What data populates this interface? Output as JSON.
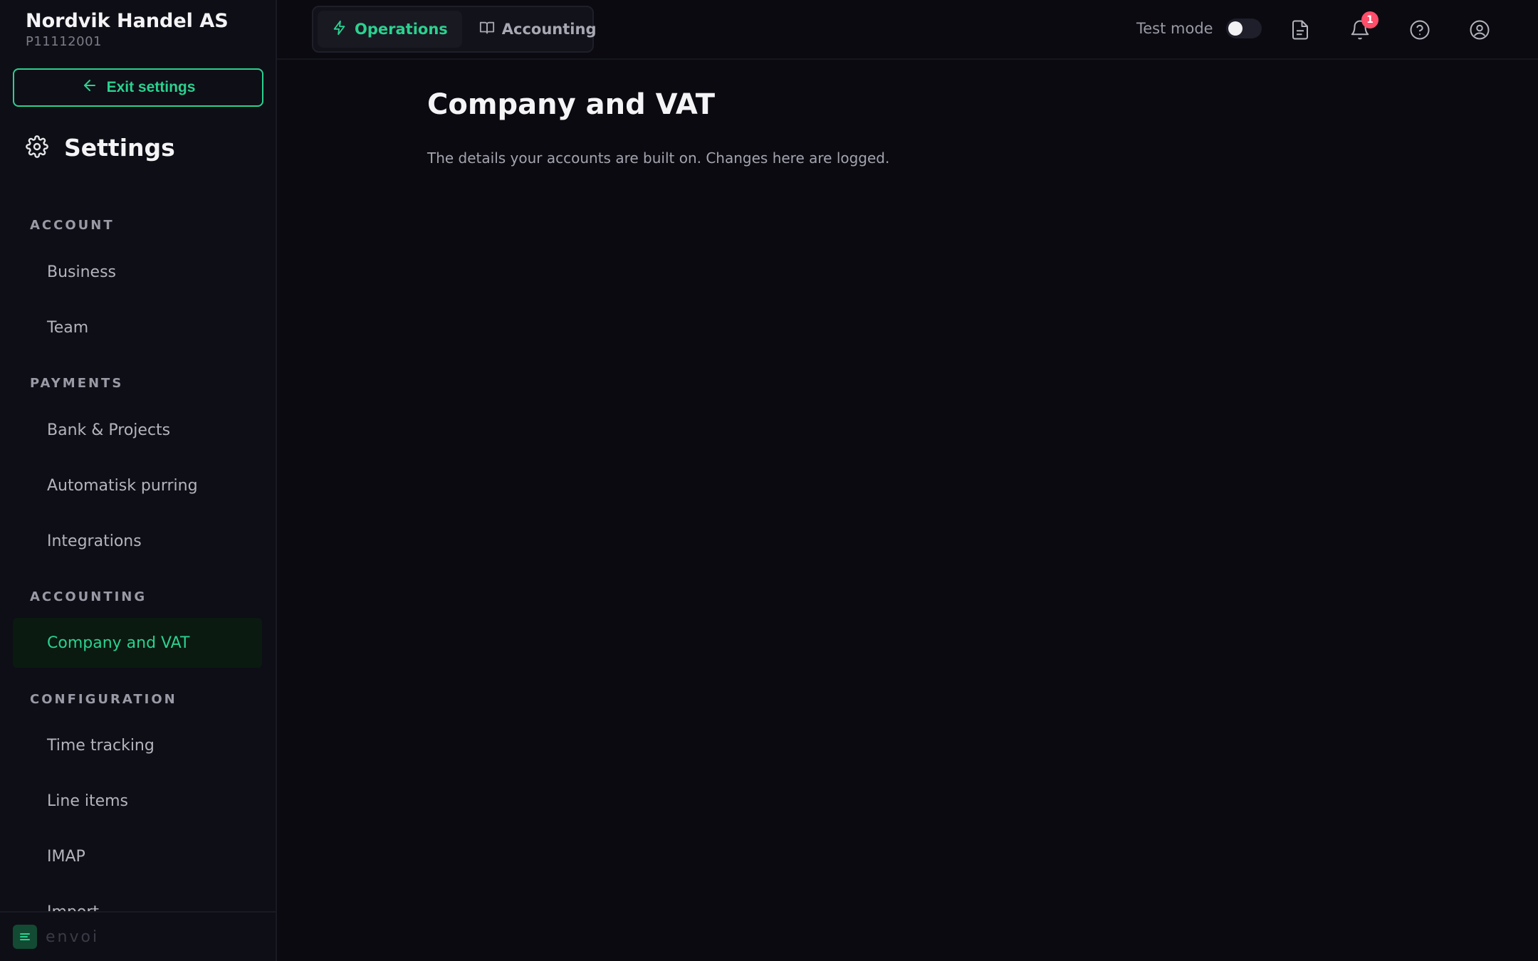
{
  "sidebar": {
    "company_name": "Nordvik Handel AS",
    "company_id": "P11112001",
    "exit_label": "Exit settings",
    "settings_title": "Settings",
    "sections": {
      "account": "ACCOUNT",
      "payments": "PAYMENTS",
      "accounting": "ACCOUNTING",
      "configuration": "CONFIGURATION"
    },
    "items": {
      "business": "Business",
      "team": "Team",
      "bank_projects": "Bank & Projects",
      "automatisk_purring": "Automatisk purring",
      "integrations": "Integrations",
      "company_vat": "Company and VAT",
      "time_tracking": "Time tracking",
      "line_items": "Line items",
      "imap": "IMAP",
      "import": "Import"
    },
    "active_item": "Company and VAT",
    "footer_brand": "envoi"
  },
  "topbar": {
    "tabs": [
      {
        "label": "Operations",
        "icon": "lightning-icon",
        "active": true
      },
      {
        "label": "Accounting",
        "icon": "book-icon",
        "active": false
      }
    ],
    "test_mode_label": "Test mode",
    "test_mode_on": false,
    "notification_count": "1",
    "icons": [
      "document-icon",
      "bell-icon",
      "help-icon",
      "user-icon"
    ]
  },
  "main": {
    "title": "Company and VAT",
    "subtitle": "The details your accounts are built on. Changes here are logged."
  },
  "colors": {
    "accent": "#2bd18f",
    "background": "#0a0a10",
    "sidebar": "#0e0e16",
    "badge": "#ff4d6a"
  }
}
